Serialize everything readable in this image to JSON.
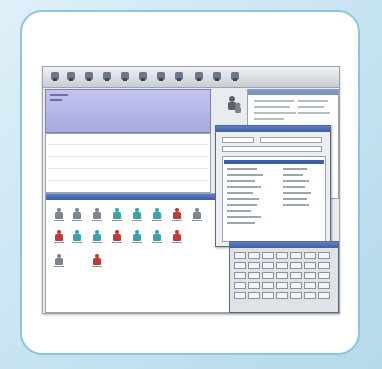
{
  "card": {
    "border_color": "#8cc5e0",
    "background": "#ffffff"
  },
  "screenshot": {
    "toolbar": {
      "icons": [
        "tool-icon",
        "tool-icon",
        "tool-icon",
        "tool-icon",
        "tool-icon",
        "tool-icon",
        "tool-icon",
        "tool-icon",
        "tool-icon",
        "tool-icon",
        "tool-icon"
      ]
    },
    "lavender_pane_color": "#b7b9e6",
    "icon_grid": {
      "row1": [
        "grey",
        "grey",
        "grey",
        "teal",
        "teal",
        "teal",
        "red",
        "grey"
      ],
      "row2": [
        "red",
        "teal",
        "teal",
        "red",
        "teal",
        "teal",
        "red"
      ],
      "row3": [
        "grey",
        "red"
      ]
    },
    "colors": {
      "accent": "#3e5fa6",
      "red": "#c43a32",
      "teal": "#3aa3a8",
      "grey": "#7d8590"
    }
  }
}
